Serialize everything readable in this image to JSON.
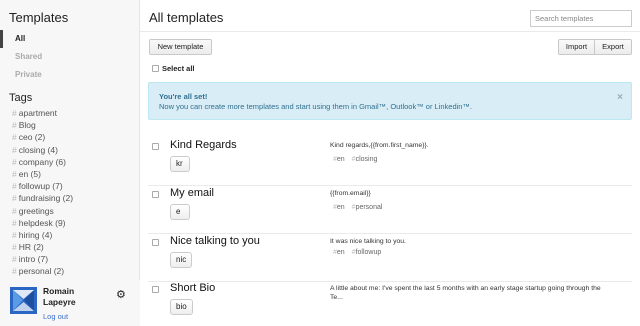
{
  "sidebar": {
    "title": "Templates",
    "nav": [
      {
        "label": "All",
        "active": true
      },
      {
        "label": "Shared",
        "active": false
      },
      {
        "label": "Private",
        "active": false
      }
    ],
    "tags_title": "Tags",
    "tags": [
      {
        "label": "apartment"
      },
      {
        "label": "Blog"
      },
      {
        "label": "ceo (2)"
      },
      {
        "label": "closing (4)"
      },
      {
        "label": "company (6)"
      },
      {
        "label": "en (5)"
      },
      {
        "label": "followup (7)"
      },
      {
        "label": "fundraising (2)"
      },
      {
        "label": "greetings"
      },
      {
        "label": "helpdesk (9)"
      },
      {
        "label": "hiring (4)"
      },
      {
        "label": "HR (2)"
      },
      {
        "label": "intro (7)"
      },
      {
        "label": "personal (2)"
      }
    ],
    "tag_prefix": "#"
  },
  "user": {
    "first_name": "Romain",
    "last_name": "Lapeyre",
    "logout_label": "Log out",
    "settings_icon": "gear-icon"
  },
  "main": {
    "title": "All templates",
    "search_placeholder": "Search templates",
    "new_template_label": "New template",
    "import_label": "Import",
    "export_label": "Export",
    "select_all_label": "Select all"
  },
  "alert": {
    "title": "You're all set!",
    "text": "Now you can create more templates and start using them in Gmail™, Outlook™ or Linkedin™.",
    "close_symbol": "×",
    "colors": {
      "background": "#d9edf7",
      "text": "#31708f"
    }
  },
  "templates": [
    {
      "name": "Kind Regards",
      "shortcut": "kr",
      "body": "Kind regards,{{from.first_name}}.",
      "tags": [
        "en",
        "closing"
      ]
    },
    {
      "name": "My email",
      "shortcut": "e",
      "body": "{{from.email}}",
      "tags": [
        "en",
        "personal"
      ]
    },
    {
      "name": "Nice talking to you",
      "shortcut": "nic",
      "body": "It was nice talking to you.",
      "tags": [
        "en",
        "followup"
      ]
    },
    {
      "name": "Short Bio",
      "shortcut": "bio",
      "body": "A little about me: I've spent the last 5 months with an early stage startup going through the Te...",
      "tags": []
    }
  ]
}
